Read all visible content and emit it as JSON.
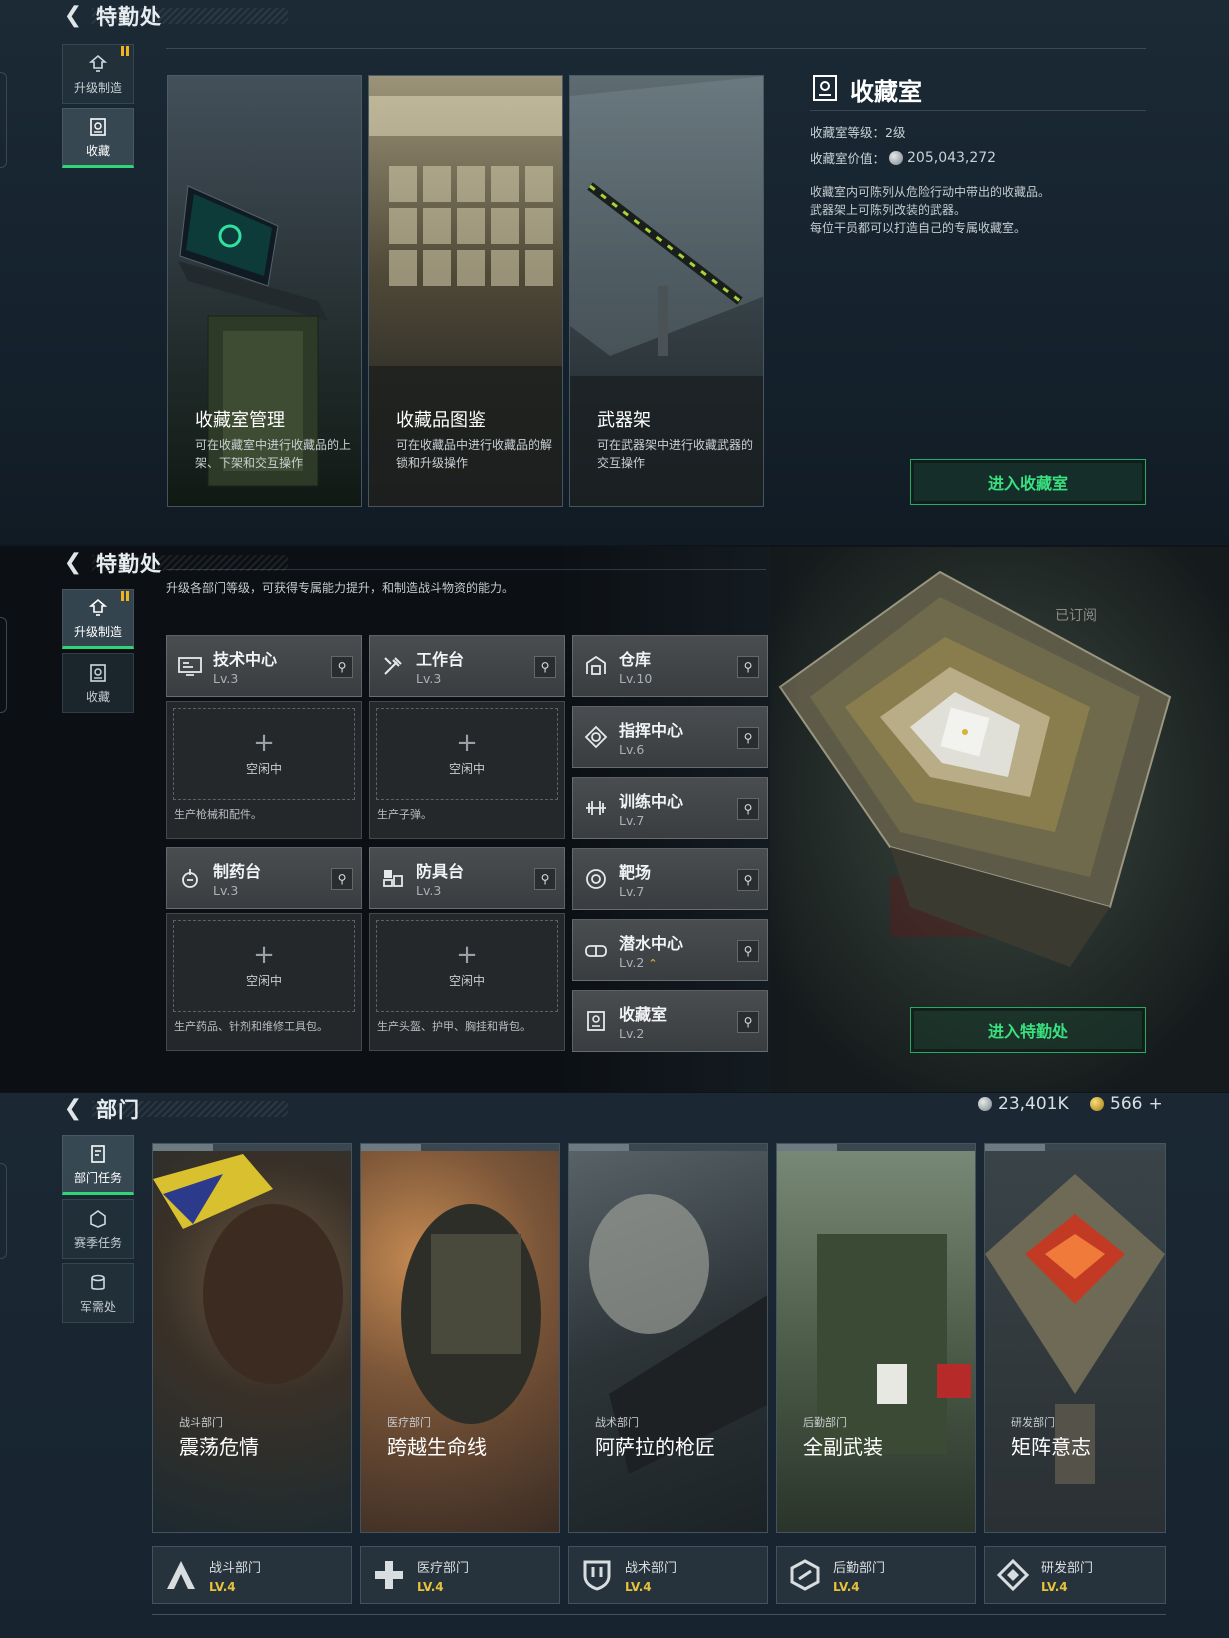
{
  "panel1": {
    "header": {
      "title": "特勤处"
    },
    "nav": [
      {
        "label": "升级制造",
        "icon": "upgrade-icon"
      },
      {
        "label": "收藏",
        "icon": "collection-icon"
      }
    ],
    "cards": [
      {
        "title": "收藏室管理",
        "desc": "可在收藏室中进行收藏品的上架、下架和交互操作"
      },
      {
        "title": "收藏品图鉴",
        "desc": "可在收藏品中进行收藏品的解锁和升级操作"
      },
      {
        "title": "武器架",
        "desc": "可在武器架中进行收藏武器的交互操作"
      }
    ],
    "info": {
      "title": "收藏室",
      "level_label": "收藏室等级：",
      "level_value": "2级",
      "value_label": "收藏室价值：",
      "value_amount": "205,043,272",
      "desc1": "收藏室内可陈列从危险行动中带出的收藏品。",
      "desc2": "武器架上可陈列改装的武器。",
      "desc3": "每位干员都可以打造自己的专属收藏室。"
    },
    "enter_button": "进入收藏室"
  },
  "panel2": {
    "header": {
      "title": "特勤处"
    },
    "nav": [
      {
        "label": "升级制造",
        "icon": "upgrade-icon"
      },
      {
        "label": "收藏",
        "icon": "collection-icon"
      }
    ],
    "subtitle": "升级各部门等级，可获得专属能力提升，和制造战斗物资的能力。",
    "subscribed": "已订阅",
    "workshops": [
      {
        "name": "技术中心",
        "level": "Lv.3",
        "idle": "空闲中",
        "produce": "生产枪械和配件。"
      },
      {
        "name": "工作台",
        "level": "Lv.3",
        "idle": "空闲中",
        "produce": "生产子弹。"
      },
      {
        "name": "制药台",
        "level": "Lv.3",
        "idle": "空闲中",
        "produce": "生产药品、针剂和维修工具包。"
      },
      {
        "name": "防具台",
        "level": "Lv.3",
        "idle": "空闲中",
        "produce": "生产头盔、护甲、胸挂和背包。"
      }
    ],
    "facilities": [
      {
        "name": "仓库",
        "level": "Lv.10"
      },
      {
        "name": "指挥中心",
        "level": "Lv.6"
      },
      {
        "name": "训练中心",
        "level": "Lv.7"
      },
      {
        "name": "靶场",
        "level": "Lv.7"
      },
      {
        "name": "潜水中心",
        "level": "Lv.2"
      },
      {
        "name": "收藏室",
        "level": "Lv.2"
      }
    ],
    "enter_button": "进入特勤处"
  },
  "panel3": {
    "header": {
      "title": "部门"
    },
    "currency": {
      "coins": "23,401K",
      "gold": "566"
    },
    "nav": [
      {
        "label": "部门任务",
        "icon": "mission-icon"
      },
      {
        "label": "赛季任务",
        "icon": "season-icon"
      },
      {
        "label": "军需处",
        "icon": "supply-icon"
      }
    ],
    "missions": [
      {
        "category": "战斗部门",
        "name": "震荡危情"
      },
      {
        "category": "医疗部门",
        "name": "跨越生命线"
      },
      {
        "category": "战术部门",
        "name": "阿萨拉的枪匠"
      },
      {
        "category": "后勤部门",
        "name": "全副武装"
      },
      {
        "category": "研发部门",
        "name": "矩阵意志"
      }
    ],
    "departments": [
      {
        "name": "战斗部门",
        "level": "LV.4"
      },
      {
        "name": "医疗部门",
        "level": "LV.4"
      },
      {
        "name": "战术部门",
        "level": "LV.4"
      },
      {
        "name": "后勤部门",
        "level": "LV.4"
      },
      {
        "name": "研发部门",
        "level": "LV.4"
      }
    ]
  }
}
